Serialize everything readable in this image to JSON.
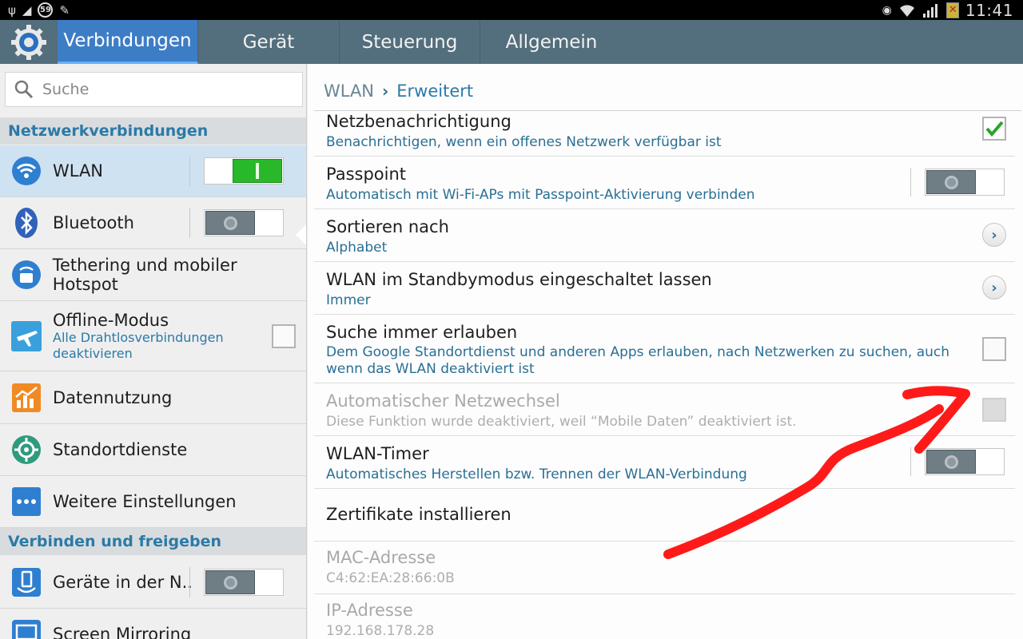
{
  "status_bar": {
    "time": "11:41",
    "notification_badge": "59",
    "icons": [
      "usb-icon",
      "data-icon",
      "badge-icon",
      "pencil-icon",
      "eye-icon",
      "wifi-icon",
      "signal-icon",
      "battery-icon"
    ]
  },
  "tabs": [
    {
      "label": "Verbindungen",
      "active": true
    },
    {
      "label": "Gerät",
      "active": false
    },
    {
      "label": "Steuerung",
      "active": false
    },
    {
      "label": "Allgemein",
      "active": false
    }
  ],
  "sidebar": {
    "search_placeholder": "Suche",
    "sections": [
      {
        "title": "Netzwerkverbindungen"
      },
      {
        "title": "Verbinden und freigeben"
      }
    ],
    "items": [
      {
        "label": "WLAN",
        "icon": "wifi-icon",
        "toggle": "on",
        "active": true
      },
      {
        "label": "Bluetooth",
        "icon": "bluetooth-icon",
        "toggle": "off"
      },
      {
        "label": "Tethering und mobiler Hotspot",
        "icon": "hotspot-icon"
      },
      {
        "label": "Offline-Modus",
        "sublabel": "Alle Drahtlosverbindungen deaktivieren",
        "icon": "airplane-icon",
        "checkbox": false
      },
      {
        "label": "Datennutzung",
        "icon": "data-usage-icon"
      },
      {
        "label": "Standortdienste",
        "icon": "location-icon"
      },
      {
        "label": "Weitere Einstellungen",
        "icon": "more-icon"
      },
      {
        "label": "Geräte in der N..",
        "icon": "nearby-devices-icon",
        "toggle": "off"
      },
      {
        "label": "Screen Mirroring",
        "icon": "screen-mirroring-icon"
      }
    ]
  },
  "main": {
    "breadcrumb": {
      "parent": "WLAN",
      "current": "Erweitert"
    },
    "rows": [
      {
        "title": "Netzbenachrichtigung",
        "subtitle": "Benachrichtigen, wenn ein offenes Netzwerk verfügbar ist",
        "control": "checkbox",
        "checked": true
      },
      {
        "title": "Passpoint",
        "subtitle": "Automatisch mit Wi-Fi-APs mit Passpoint-Aktivierung verbinden",
        "control": "switch",
        "state": "off"
      },
      {
        "title": "Sortieren nach",
        "subtitle": "Alphabet",
        "control": "chevron"
      },
      {
        "title": "WLAN im Standbymodus eingeschaltet lassen",
        "subtitle": "Immer",
        "control": "chevron"
      },
      {
        "title": "Suche immer erlauben",
        "subtitle": "Dem Google Standortdienst und anderen Apps erlauben, nach Netzwerken zu suchen, auch wenn das WLAN deaktiviert ist",
        "control": "checkbox",
        "checked": false
      },
      {
        "title": "Automatischer Netzwechsel",
        "subtitle": "Diese Funktion wurde deaktiviert, weil “Mobile Daten” deaktiviert ist.",
        "control": "checkbox",
        "checked": false,
        "disabled": true
      },
      {
        "title": "WLAN-Timer",
        "subtitle": "Automatisches Herstellen bzw. Trennen der WLAN-Verbindung",
        "control": "switch",
        "state": "off"
      },
      {
        "title": "Zertifikate installieren"
      },
      {
        "title": "MAC-Adresse",
        "subtitle": "C4:62:EA:28:66:0B",
        "disabled": true
      },
      {
        "title": "IP-Adresse",
        "subtitle": "192.168.178.28",
        "disabled": true
      }
    ]
  },
  "colors": {
    "tab_bar": "#536e7c",
    "active_tab": "#3d7dc5",
    "accent_text": "#2b7aa7",
    "switch_on": "#29b829",
    "annotation_arrow": "#ff1a1a"
  }
}
